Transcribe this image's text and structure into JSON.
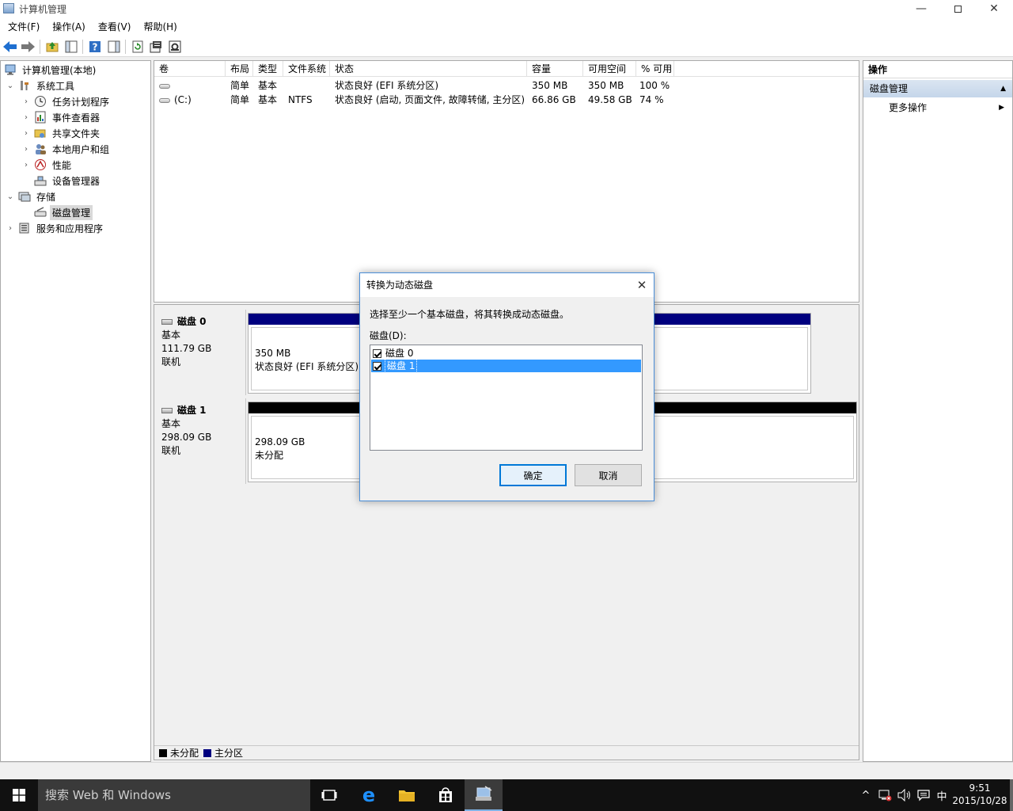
{
  "window": {
    "title": "计算机管理"
  },
  "menu": [
    "文件(F)",
    "操作(A)",
    "查看(V)",
    "帮助(H)"
  ],
  "tree": [
    {
      "label": "计算机管理(本地)"
    },
    {
      "label": "系统工具"
    },
    {
      "label": "任务计划程序"
    },
    {
      "label": "事件查看器"
    },
    {
      "label": "共享文件夹"
    },
    {
      "label": "本地用户和组"
    },
    {
      "label": "性能"
    },
    {
      "label": "设备管理器"
    },
    {
      "label": "存储"
    },
    {
      "label": "磁盘管理"
    },
    {
      "label": "服务和应用程序"
    }
  ],
  "volumes": {
    "columns": [
      "卷",
      "布局",
      "类型",
      "文件系统",
      "状态",
      "容量",
      "可用空间",
      "% 可用"
    ],
    "rows": [
      [
        "",
        "简单",
        "基本",
        "",
        "状态良好 (EFI 系统分区)",
        "350 MB",
        "350 MB",
        "100 %"
      ],
      [
        "(C:)",
        "简单",
        "基本",
        "NTFS",
        "状态良好 (启动, 页面文件, 故障转储, 主分区)",
        "66.86 GB",
        "49.58 GB",
        "74 %"
      ]
    ]
  },
  "disks": [
    {
      "name": "磁盘 0",
      "type": "基本",
      "size": "111.79 GB",
      "status": "联机",
      "part_size": "350 MB",
      "part_status": "状态良好 (EFI 系统分区)"
    },
    {
      "name": "磁盘 1",
      "type": "基本",
      "size": "298.09 GB",
      "status": "联机",
      "part_size": "298.09 GB",
      "part_status": "未分配"
    }
  ],
  "legend": {
    "unallocated": "未分配",
    "primary": "主分区"
  },
  "actions": {
    "header": "操作",
    "group": "磁盘管理",
    "more": "更多操作"
  },
  "dialog": {
    "title": "转换为动态磁盘",
    "prompt": "选择至少一个基本磁盘，将其转换成动态磁盘。",
    "list_label": "磁盘(D):",
    "items": [
      "磁盘 0",
      "磁盘 1"
    ],
    "ok": "确定",
    "cancel": "取消"
  },
  "taskbar": {
    "search_placeholder": "搜索 Web 和 Windows",
    "ime": "中",
    "time": "9:51",
    "date": "2015/10/28"
  },
  "colors": {
    "primary_partition": "#00007f",
    "unallocated": "#000000",
    "selection": "#3399ff",
    "accent": "#0078d7"
  }
}
